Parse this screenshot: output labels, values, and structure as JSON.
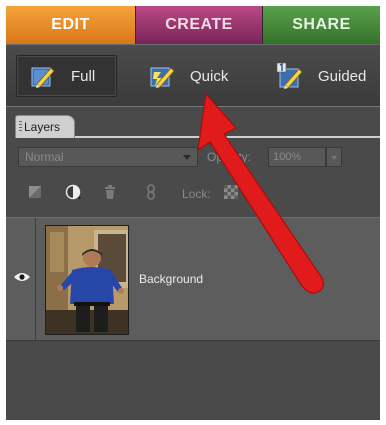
{
  "tabs": {
    "edit": "EDIT",
    "create": "CREATE",
    "share": "SHARE"
  },
  "modes": {
    "full": "Full",
    "quick": "Quick",
    "guided": "Guided"
  },
  "panel": {
    "tab_label": "Layers",
    "blend_mode": "Normal",
    "opacity_label": "Opacity:",
    "opacity_value": "100%",
    "lock_label": "Lock:",
    "layers": [
      {
        "name": "Background",
        "visible": true
      }
    ]
  },
  "icons": {
    "modes": [
      "pencil-ruler-icon",
      "lightning-pencil-icon",
      "numbered-pencil-icon"
    ],
    "tools": [
      "new-layer-icon",
      "adjustment-layer-icon",
      "trash-icon",
      "link-icon",
      "lock-transparency-icon"
    ],
    "annotation": "red-arrow"
  },
  "colors": {
    "edit_tab": "#e88c28",
    "create_tab": "#9b3570",
    "share_tab": "#4a8c3e",
    "annotation_arrow": "#e11b1b"
  }
}
